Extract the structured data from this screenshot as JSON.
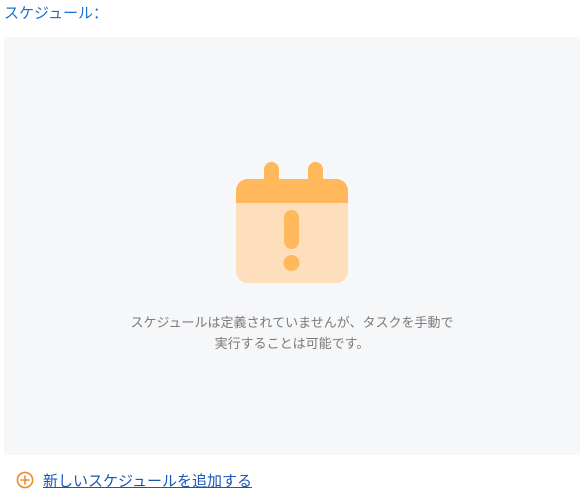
{
  "section": {
    "title": "スケジュール："
  },
  "empty_state": {
    "icon": "calendar-warning-icon",
    "line1": "スケジュールは定義されていませんが、タスクを手動で",
    "line2": "実行することは可能です。"
  },
  "actions": {
    "add_icon": "plus-circle-icon",
    "add_label": "新しいスケジュールを追加する"
  },
  "colors": {
    "accent_blue": "#1a6fd1",
    "link_blue": "#1a55b8",
    "icon_orange": "#ffb85c",
    "icon_body": "#fddfbe",
    "add_icon_orange": "#f28c28",
    "panel_bg": "#f6f7f9"
  }
}
